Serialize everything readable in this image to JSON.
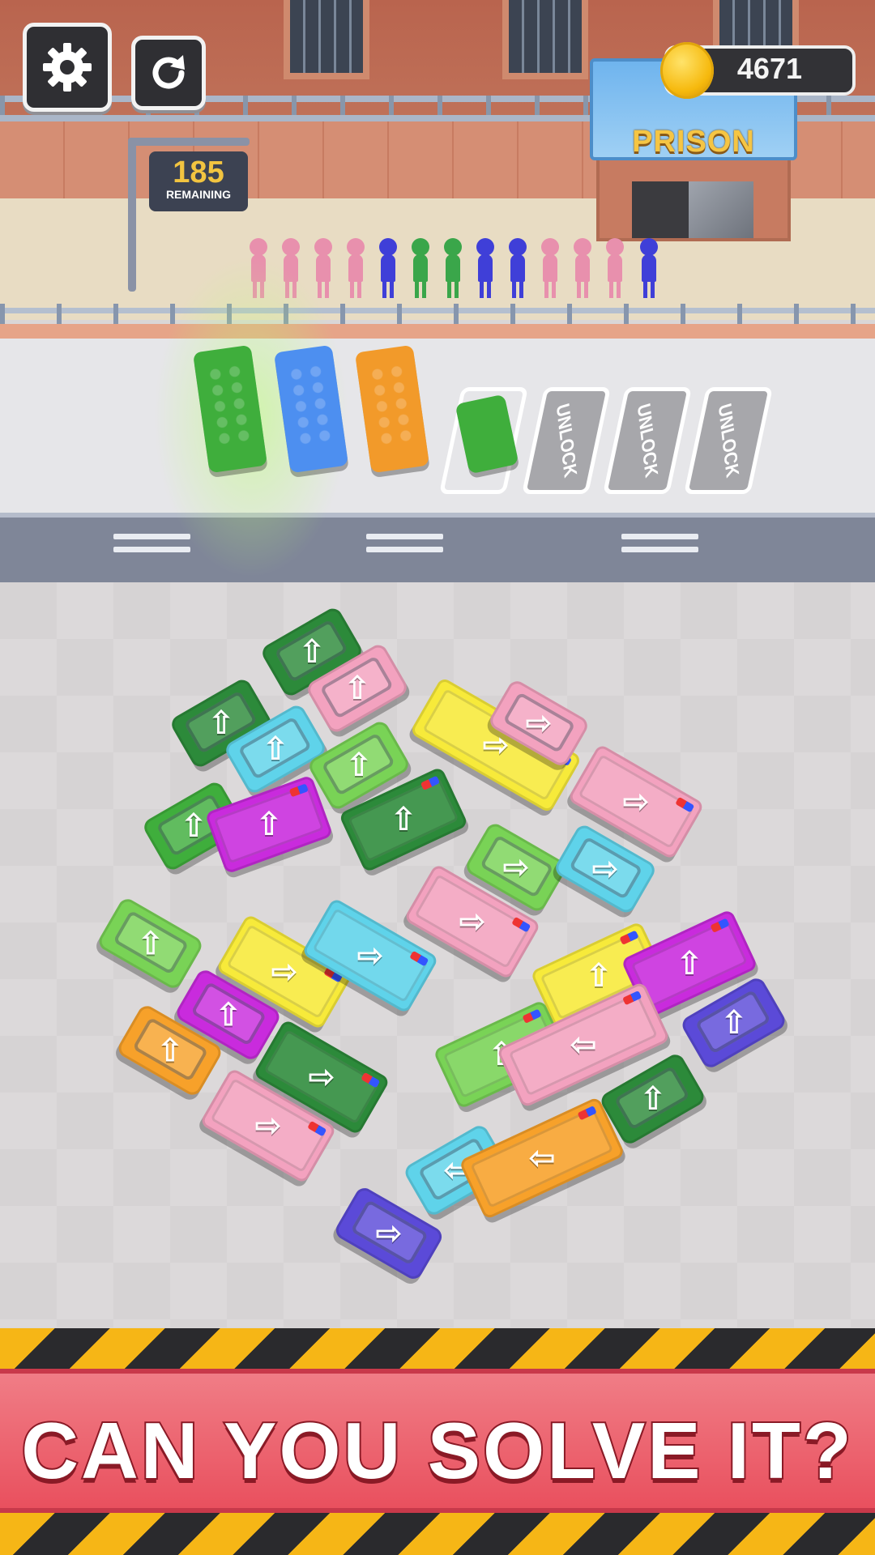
{
  "hud": {
    "settings_icon": "gear-icon",
    "restart_icon": "restart-icon",
    "coins": "4671",
    "coin_icon": "gold-coin-icon",
    "remaining_count": "185",
    "remaining_label": "REMAINING"
  },
  "building": {
    "sign": "PRISON"
  },
  "parking": {
    "slots": [
      {
        "state": "occupied",
        "vehicle": "green bus"
      },
      {
        "state": "occupied",
        "vehicle": "blue bus"
      },
      {
        "state": "occupied",
        "vehicle": "orange bus"
      },
      {
        "state": "occupied",
        "vehicle": "green car"
      },
      {
        "state": "locked",
        "label": "UNLOCK"
      },
      {
        "state": "locked",
        "label": "UNLOCK"
      },
      {
        "state": "locked",
        "label": "UNLOCK"
      }
    ]
  },
  "queue_colors": [
    "pink",
    "pink",
    "pink",
    "pink",
    "blue",
    "green",
    "green",
    "blue",
    "blue",
    "pink",
    "pink",
    "pink",
    "blue"
  ],
  "colors": {
    "green": "#3fae3c",
    "dark_green": "#2c8a3a",
    "light_green": "#79d356",
    "pink": "#f3a2bf",
    "cyan": "#5fd3ea",
    "yellow": "#f7ea3a",
    "magenta": "#c92bdd",
    "orange": "#f7a12a",
    "blue": "#5b4ad8",
    "banner": "#e9505e"
  },
  "banner": {
    "text": "CAN YOU SOLVE IT?"
  }
}
